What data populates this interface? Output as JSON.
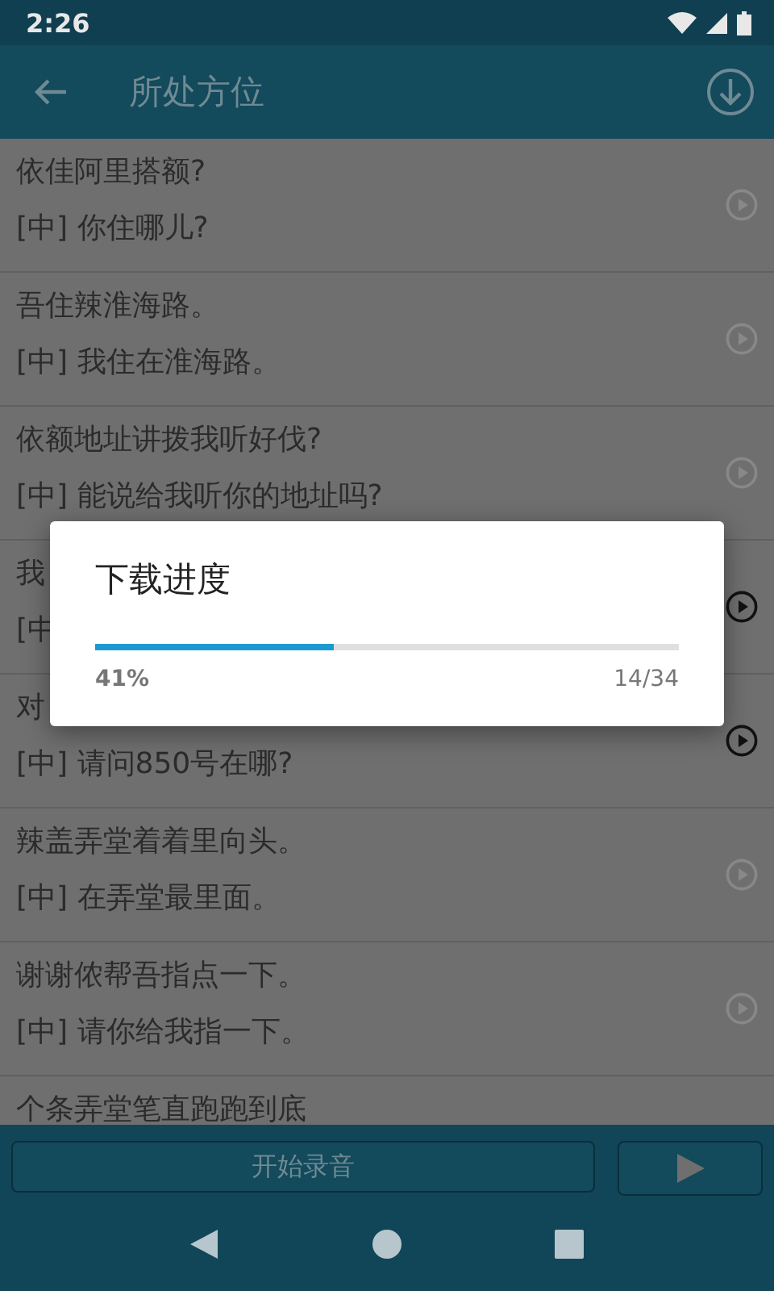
{
  "status_bar": {
    "time": "2:26"
  },
  "toolbar": {
    "title": "所处方位"
  },
  "rows": [
    {
      "text": "依佳阿里搭额?",
      "translation": "[中] 你住哪儿?",
      "active": false
    },
    {
      "text": "吾住辣淮海路。",
      "translation": "[中] 我住在淮海路。",
      "active": false
    },
    {
      "text": "依额地址讲拨我听好伐?",
      "translation": "[中] 能说给我听你的地址吗?",
      "active": false
    },
    {
      "text": "我",
      "translation": "[中",
      "active": true
    },
    {
      "text": "对",
      "translation": "[中] 请问850号在哪?",
      "active": true
    },
    {
      "text": "辣盖弄堂着着里向头。",
      "translation": "[中] 在弄堂最里面。",
      "active": false
    },
    {
      "text": "谢谢侬帮吾指点一下。",
      "translation": "[中] 请你给我指一下。",
      "active": false
    },
    {
      "text": "个条弄堂笔直跑跑到底"
    }
  ],
  "dialog": {
    "title": "下载进度",
    "progress": {
      "level": 0.41
    },
    "percent": "41%",
    "count": "14/34"
  },
  "bottom_bar": {
    "record_button": "开始录音"
  }
}
